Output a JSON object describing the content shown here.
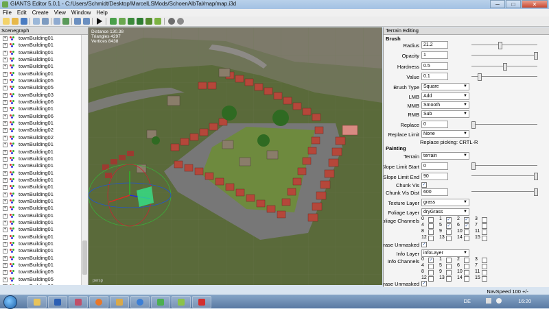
{
  "window": {
    "title": "GIANTS Editor 5.0.1 - C:/Users/Schmidt/Desktop/MarcelLSMods/SchoenAlbTal/map/map.i3d",
    "min": "─",
    "max": "□",
    "close": "✕"
  },
  "menu": [
    "File",
    "Edit",
    "Create",
    "View",
    "Window",
    "Help"
  ],
  "scenegraph": {
    "title": "Scenegraph",
    "items": [
      "townBuilding01",
      "townBuilding01",
      "townBuilding01",
      "townBuilding01",
      "townBuilding01",
      "townBuilding01",
      "townBuilding05",
      "townBuilding05",
      "townBuilding03",
      "townBuilding06",
      "townBuilding01",
      "townBuilding06",
      "townBuilding01",
      "townBuilding02",
      "townBuilding02",
      "townBuilding01",
      "townBuilding01",
      "townBuilding01",
      "townBuilding01",
      "townBuilding01",
      "townBuilding01",
      "townBuilding01",
      "townBuilding01",
      "townBuilding01",
      "townBuilding01",
      "townBuilding01",
      "townBuilding01",
      "townBuilding01",
      "townBuilding01",
      "townBuilding01",
      "townBuilding01",
      "townBuilding01",
      "townBuilding01",
      "townBuilding05",
      "townBuilding05",
      "townBuilding06"
    ]
  },
  "viewport": {
    "stats": [
      "Distance 130.38",
      "Triangles 4297",
      "Vertices 8438"
    ],
    "camera": "persp"
  },
  "terrain_editing": {
    "title": "Terrain Editing",
    "brush_title": "Brush",
    "radius": {
      "label": "Radius",
      "value": "21.2",
      "slider": 0.43
    },
    "opacity": {
      "label": "Opacity",
      "value": "1",
      "slider": 1.0
    },
    "hardness": {
      "label": "Hardness",
      "value": "0.5",
      "slider": 0.5
    },
    "value": {
      "label": "Value",
      "value": "0.1",
      "slider": 0.1
    },
    "brush_type": {
      "label": "Brush Type",
      "value": "Square"
    },
    "lmb": {
      "label": "LMB",
      "value": "Add"
    },
    "mmb": {
      "label": "MMB",
      "value": "Smooth"
    },
    "rmb": {
      "label": "RMB",
      "value": "Sub"
    },
    "replace": {
      "label": "Replace",
      "value": "0",
      "slider": 0.0
    },
    "replace_limit": {
      "label": "Replace Limit",
      "value": "None"
    },
    "replace_hint": "Replace picking: CRTL-R",
    "painting_title": "Painting",
    "terrain": {
      "label": "Terrain",
      "value": "terrain"
    },
    "slope_start": {
      "label": "Slope Limit Start",
      "value": "0",
      "slider": 0.0
    },
    "slope_end": {
      "label": "Slope Limit End",
      "value": "90",
      "slider": 1.0
    },
    "chunk_vis": {
      "label": "Chunk Vis",
      "checked": true
    },
    "chunk_vis_dist": {
      "label": "Chunk Vis Dist",
      "value": "600",
      "slider": 1.0
    },
    "texture_layer": {
      "label": "Texture Layer",
      "value": "grass"
    },
    "foliage_layer": {
      "label": "Foliage Layer",
      "value": "dryGrass"
    },
    "foliage_channels": {
      "label": "Foliage Channels",
      "numbers": [
        "0",
        "1",
        "2",
        "3",
        "4",
        "5",
        "6",
        "7",
        "8",
        "9",
        "10",
        "11",
        "12",
        "13",
        "14",
        "15"
      ],
      "checked": [
        false,
        true,
        true,
        false,
        false,
        true,
        true,
        false,
        false,
        false,
        false,
        false,
        false,
        false,
        false,
        false
      ]
    },
    "erase_unmasked_1": {
      "label": "Erase Unmasked",
      "checked": true
    },
    "info_layer": {
      "label": "Info Layer",
      "value": "infoLayer"
    },
    "info_channels": {
      "label": "Info Channels",
      "numbers": [
        "0",
        "1",
        "2",
        "3",
        "4",
        "5",
        "6",
        "7",
        "8",
        "9",
        "10",
        "11",
        "12",
        "13",
        "14",
        "15"
      ],
      "checked": [
        true,
        false,
        false,
        false,
        false,
        false,
        false,
        false,
        false,
        false,
        false,
        false,
        false,
        false,
        false,
        false
      ]
    },
    "erase_unmasked_2": {
      "label": "Erase Unmasked",
      "checked": true
    }
  },
  "status": {
    "navspeed": "NavSpeed 100 +/-"
  },
  "taskbar": {
    "lang": "DE",
    "time": "16:20"
  }
}
